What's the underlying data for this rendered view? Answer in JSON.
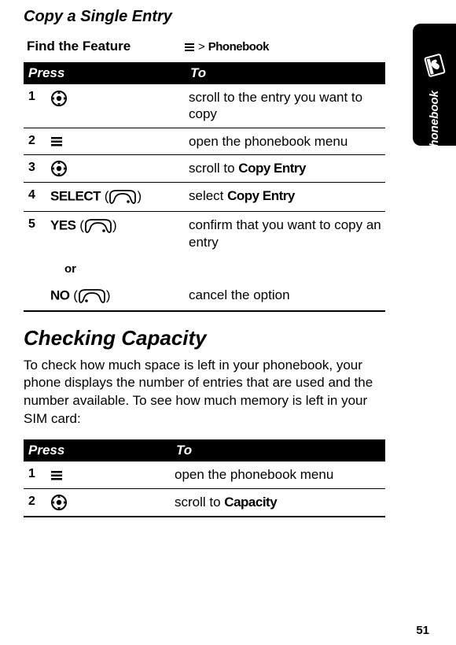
{
  "tab_label": "Phonebook",
  "subtitle": "Copy a Single Entry",
  "find_feature_label": "Find the Feature",
  "breadcrumb_separator": ">",
  "breadcrumb_target": "Phonebook",
  "table1": {
    "headers": {
      "press": "Press",
      "to": "To"
    },
    "rows": [
      {
        "num": "1",
        "press_icon": "nav",
        "to_pre": "scroll to the entry you want to copy"
      },
      {
        "num": "2",
        "press_icon": "menu",
        "to_pre": "open the phonebook menu"
      },
      {
        "num": "3",
        "press_icon": "nav",
        "to_pre": "scroll to ",
        "to_narrow": "Copy Entry"
      },
      {
        "num": "4",
        "press_label": "SELECT",
        "press_softkey": "right",
        "to_pre": "select ",
        "to_narrow": "Copy Entry"
      },
      {
        "num": "5",
        "press_label": "YES",
        "press_softkey": "right",
        "to_pre": "confirm that you want to copy an entry"
      }
    ],
    "or_text": "or",
    "alt_row": {
      "press_label": "NO",
      "press_softkey": "left",
      "to_pre": "cancel the option"
    }
  },
  "section_heading": "Checking Capacity",
  "section_body": "To check how much space is left in your phonebook, your phone displays the number of entries that are used and the number available. To see how much memory is left in your SIM card:",
  "table2": {
    "headers": {
      "press": "Press",
      "to": "To"
    },
    "rows": [
      {
        "num": "1",
        "press_icon": "menu",
        "to_pre": "open the phonebook menu"
      },
      {
        "num": "2",
        "press_icon": "nav",
        "to_pre": "scroll to ",
        "to_narrow": "Capacity"
      }
    ]
  },
  "page_number": "51"
}
